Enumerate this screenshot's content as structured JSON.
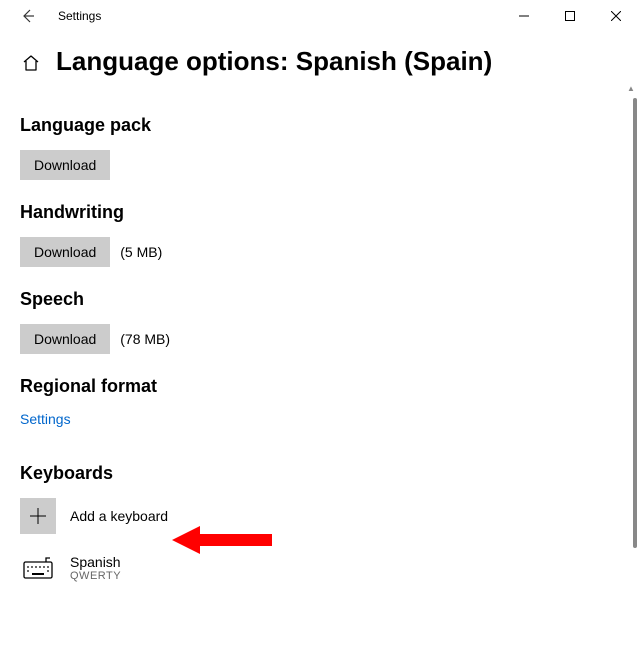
{
  "app": {
    "title": "Settings"
  },
  "page": {
    "title": "Language options: Spanish (Spain)"
  },
  "sections": {
    "language_pack": {
      "heading": "Language pack",
      "button": "Download"
    },
    "handwriting": {
      "heading": "Handwriting",
      "button": "Download",
      "size": "(5 MB)"
    },
    "speech": {
      "heading": "Speech",
      "button": "Download",
      "size": "(78 MB)"
    },
    "regional": {
      "heading": "Regional format",
      "link": "Settings"
    },
    "keyboards": {
      "heading": "Keyboards",
      "add_label": "Add a keyboard",
      "items": [
        {
          "name": "Spanish",
          "layout": "QWERTY"
        }
      ]
    }
  }
}
